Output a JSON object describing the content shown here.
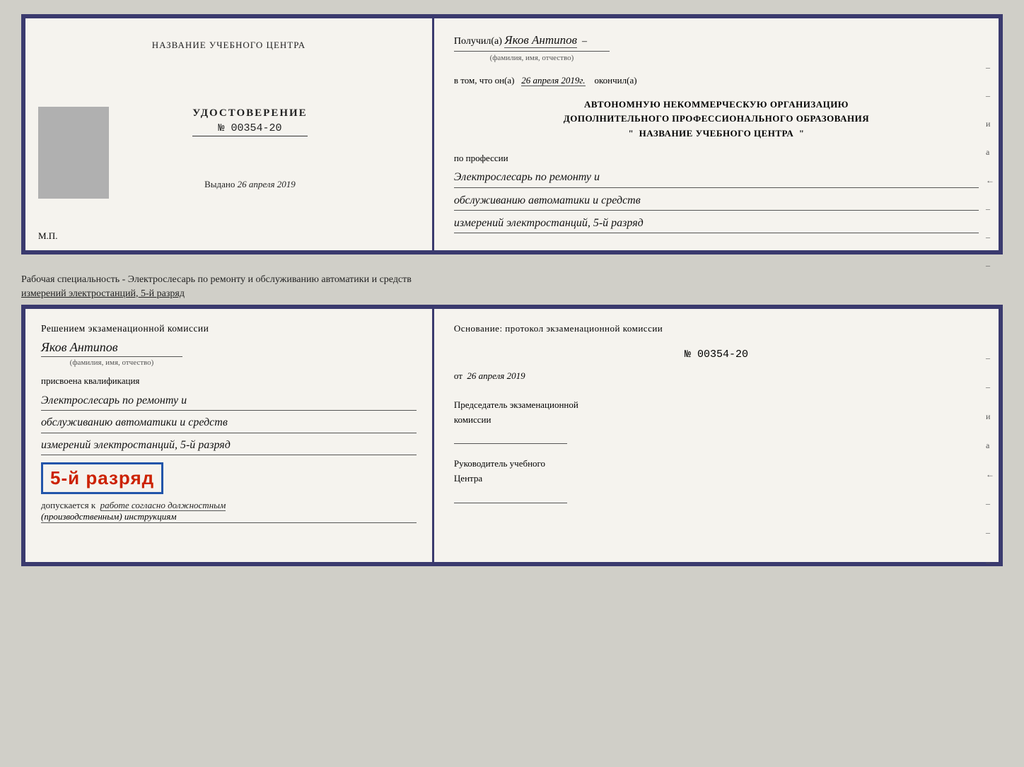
{
  "top_doc": {
    "left": {
      "org_name": "НАЗВАНИЕ УЧЕБНОГО ЦЕНТРА",
      "udostoverenie_title": "УДОСТОВЕРЕНИЕ",
      "udostoverenie_num": "№ 00354-20",
      "vydano_label": "Выдано",
      "vydano_date": "26 апреля 2019",
      "mp_label": "М.П."
    },
    "right": {
      "poluchil_label": "Получил(а)",
      "poluchil_fio": "Яков Антипов",
      "fio_subtitle": "(фамилия, имя, отчество)",
      "vtom_label": "в том, что он(а)",
      "vtom_date": "26 апреля 2019г.",
      "okonchil_label": "окончил(а)",
      "org_line1": "АВТОНОМНУЮ НЕКОММЕРЧЕСКУЮ ОРГАНИЗАЦИЮ",
      "org_line2": "ДОПОЛНИТЕЛЬНОГО ПРОФЕССИОНАЛЬНОГО ОБРАЗОВАНИЯ",
      "org_quote_open": "\"",
      "org_center": "НАЗВАНИЕ УЧЕБНОГО ЦЕНТРА",
      "org_quote_close": "\"",
      "po_professii": "по профессии",
      "profession_line1": "Электрослесарь по ремонту и",
      "profession_line2": "обслуживанию автоматики и средств",
      "profession_line3": "измерений электростанций, 5-й разряд",
      "right_marks": [
        "-",
        "-",
        "и",
        "а",
        "←",
        "-",
        "-",
        "-"
      ]
    }
  },
  "middle": {
    "text": "Рабочая специальность - Электрослесарь по ремонту и обслуживанию автоматики и средств",
    "text2": "измерений электростанций, 5-й разряд"
  },
  "bottom_doc": {
    "left": {
      "resheniem_label": "Решением экзаменационной комиссии",
      "fio": "Яков Антипов",
      "fio_subtitle": "(фамилия, имя, отчество)",
      "prisvoena": "присвоена квалификация",
      "qual_line1": "Электрослесарь по ремонту и",
      "qual_line2": "обслуживанию автоматики и средств",
      "qual_line3": "измерений электростанций, 5-й разряд",
      "razryad_text": "5-й разряд",
      "dopuskaetsya_label": "допускается к",
      "dopusk_text": "работе согласно должностным",
      "dopusk_text2": "(производственным) инструкциям"
    },
    "right": {
      "osnovanie_label": "Основание: протокол экзаменационной комиссии",
      "protocol_num": "№ 00354-20",
      "ot_label": "от",
      "ot_date": "26 апреля 2019",
      "predsedatel_line1": "Председатель экзаменационной",
      "predsedatel_line2": "комиссии",
      "rukovoditel_line1": "Руководитель учебного",
      "rukovoditel_line2": "Центра",
      "right_marks": [
        "-",
        "-",
        "и",
        "а",
        "←",
        "-",
        "-",
        "-"
      ]
    }
  }
}
